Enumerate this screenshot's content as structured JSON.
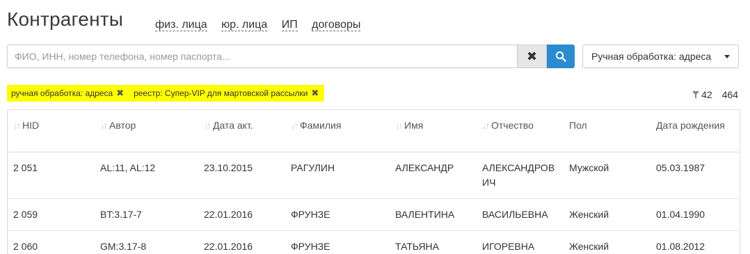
{
  "header": {
    "title": "Контрагенты",
    "links": [
      "физ. лица",
      "юр. лица",
      "ИП",
      "договоры"
    ]
  },
  "search": {
    "placeholder": "ФИО, ИНН, номер телефона, номер паспорта...",
    "value": ""
  },
  "dropdown": {
    "selected": "Ручная обработка: адреса"
  },
  "filters": {
    "chips": [
      "ручная обработка: адреса",
      "реестр: Супер-VIP для мартовской рассылки"
    ],
    "filtered_count": "42",
    "total_count": "464"
  },
  "table": {
    "columns": [
      "HID",
      "Автор",
      "Дата акт.",
      "Фамилия",
      "Имя",
      "Отчество",
      "Пол",
      "Дата рождения"
    ],
    "rows": [
      [
        "2 051",
        "AL:11, AL:12",
        "23.10.2015",
        "РАГУЛИН",
        "АЛЕКСАНДР",
        "АЛЕКСАНДРОВИЧ",
        "Мужской",
        "05.03.1987"
      ],
      [
        "2 059",
        "BT:3.17-7",
        "22.01.2016",
        "ФРУНЗЕ",
        "ВАЛЕНТИНА",
        "ВАСИЛЬЕВНА",
        "Женский",
        "01.04.1990"
      ],
      [
        "2 060",
        "GM:3.17-8",
        "22.01.2016",
        "ФРУНЗЕ",
        "ТАТЬЯНА",
        "ИГОРЕВНА",
        "Женский",
        "01.08.2012"
      ]
    ]
  },
  "colors": {
    "accent": "#2a8bd1",
    "highlight": "#ffff00"
  },
  "icons": {
    "clear": "close-icon",
    "search": "search-icon",
    "filter": "filter-icon",
    "sort": "sort-icon",
    "remove_chip": "close-icon"
  }
}
